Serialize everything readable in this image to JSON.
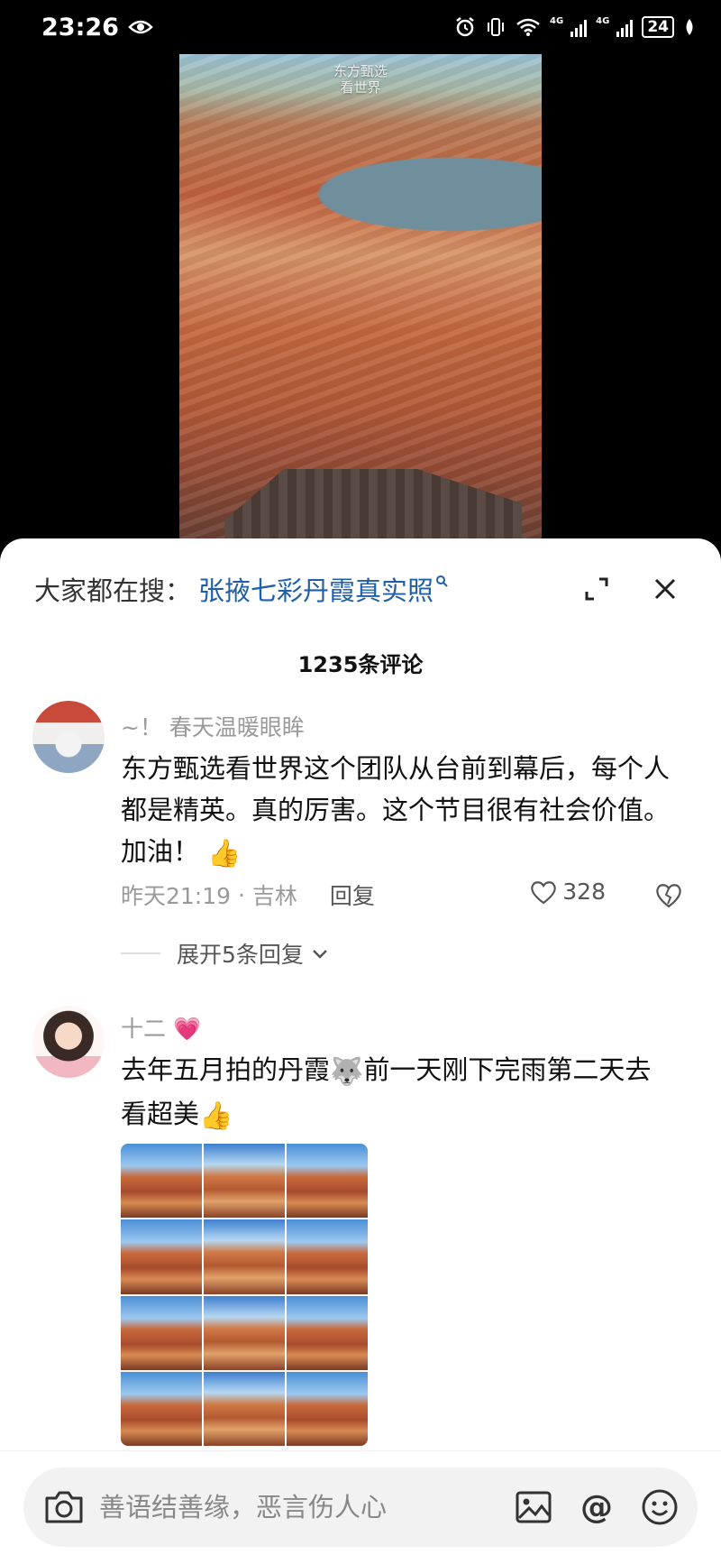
{
  "status_bar": {
    "time": "23:26",
    "network_1": "4G",
    "network_2": "4G",
    "battery": "24"
  },
  "video": {
    "watermark_line1": "东方甄选",
    "watermark_line2": "看世界"
  },
  "sheet": {
    "search_prefix": "大家都在搜：",
    "search_term": "张掖七彩丹霞真实照",
    "comment_count": "1235条评论"
  },
  "comments": [
    {
      "username": "~！ 春天温暖眼眸",
      "text": "东方甄选看世界这个团队从台前到幕后，每个人都是精英。真的厉害。这个节目很有社会价值。加油！",
      "emoji": "👍",
      "time": "昨天21:19",
      "location": "吉林",
      "reply_label": "回复",
      "likes": "328",
      "expand_replies": "展开5条回复"
    },
    {
      "username": "十二",
      "username_emoji": "💗",
      "text_part1": "去年五月拍的丹霞",
      "emoji_1": "🐺",
      "text_part2": "前一天刚下完雨第二天去看超美",
      "emoji_2": "👍"
    }
  ],
  "input": {
    "placeholder": "善语结善缘，恶言伤人心",
    "at_symbol": "@"
  },
  "colors": {
    "link_blue": "#1f5fa8",
    "muted_gray": "#9a9a9a"
  }
}
